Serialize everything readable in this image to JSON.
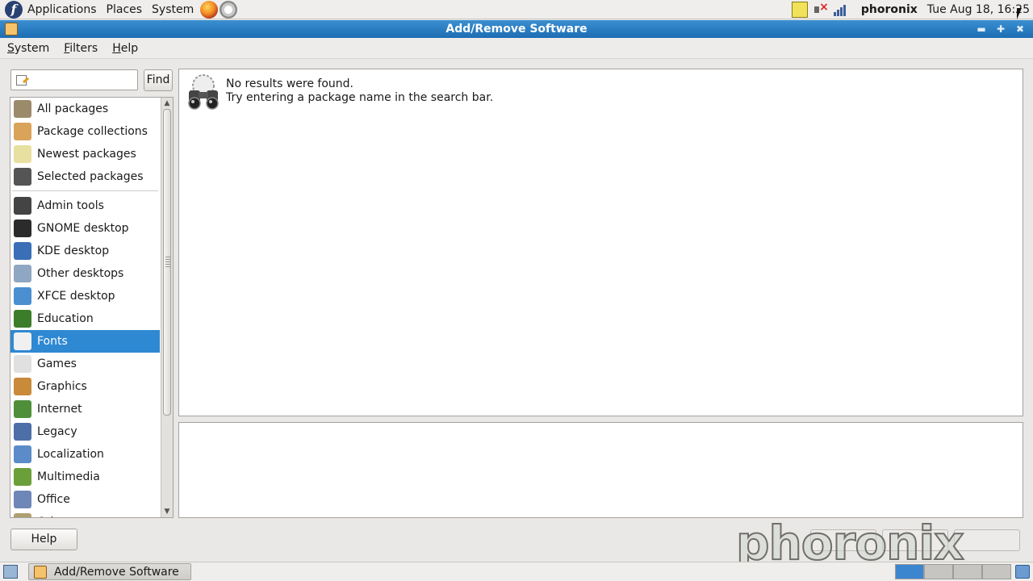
{
  "top_panel": {
    "menus": [
      "Applications",
      "Places",
      "System"
    ],
    "user": "phoronix",
    "clock": "Tue Aug 18, 16:25"
  },
  "window": {
    "title": "Add/Remove Software",
    "title_buttons": [
      "minimize",
      "maximize",
      "close"
    ]
  },
  "menubar": {
    "items": [
      {
        "mnemonic": "S",
        "rest": "ystem"
      },
      {
        "mnemonic": "F",
        "rest": "ilters"
      },
      {
        "mnemonic": "H",
        "rest": "elp"
      }
    ]
  },
  "search": {
    "value": "",
    "placeholder": "",
    "find_label": "Find"
  },
  "groups": {
    "fixed": [
      {
        "label": "All packages",
        "icon": "search-packages-icon",
        "color": "#9c8b6a"
      },
      {
        "label": "Package collections",
        "icon": "package-box-icon",
        "color": "#d9a45a"
      },
      {
        "label": "Newest packages",
        "icon": "lightbulb-icon",
        "color": "#e8e0a0"
      },
      {
        "label": "Selected packages",
        "icon": "binoculars-icon",
        "color": "#555555"
      }
    ],
    "categories": [
      {
        "label": "Admin tools",
        "icon": "admin-tools-icon",
        "color": "#444444"
      },
      {
        "label": "GNOME desktop",
        "icon": "gnome-foot-icon",
        "color": "#2b2b2b"
      },
      {
        "label": "KDE desktop",
        "icon": "kde-icon",
        "color": "#3a6fb7"
      },
      {
        "label": "Other desktops",
        "icon": "desktop-icon",
        "color": "#8fa7c2"
      },
      {
        "label": "XFCE desktop",
        "icon": "xfce-mouse-icon",
        "color": "#4a90d0"
      },
      {
        "label": "Education",
        "icon": "education-icon",
        "color": "#3c7d2a"
      },
      {
        "label": "Fonts",
        "icon": "fonts-icon",
        "color": "#f0f0f0"
      },
      {
        "label": "Games",
        "icon": "games-icon",
        "color": "#e0e0e0"
      },
      {
        "label": "Graphics",
        "icon": "graphics-palette-icon",
        "color": "#c98a3a"
      },
      {
        "label": "Internet",
        "icon": "globe-icon",
        "color": "#4f8f3a"
      },
      {
        "label": "Legacy",
        "icon": "floppy-icon",
        "color": "#4c6fa8"
      },
      {
        "label": "Localization",
        "icon": "flag-icon",
        "color": "#5b8cc9"
      },
      {
        "label": "Multimedia",
        "icon": "multimedia-icon",
        "color": "#6a9f3a"
      },
      {
        "label": "Office",
        "icon": "office-icon",
        "color": "#6f86b8"
      },
      {
        "label": "Other",
        "icon": "other-icon",
        "color": "#b0a070"
      }
    ],
    "selected": "Fonts"
  },
  "results": {
    "message_line1": "No results were found.",
    "message_line2": "Try entering a package name in the search bar."
  },
  "footer": {
    "help_label": "Help"
  },
  "watermark": "phoronix",
  "bottom_panel": {
    "task_label": "Add/Remove Software",
    "workspaces": 4,
    "active_workspace": 1
  },
  "colors": {
    "title_bar": "#1d6db4",
    "selection": "#2f89d2"
  }
}
